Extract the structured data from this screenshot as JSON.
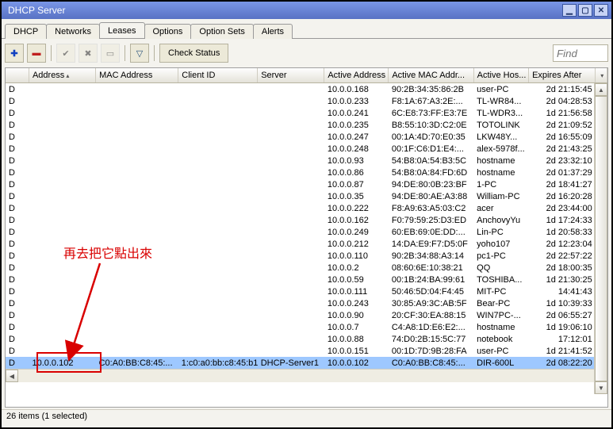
{
  "window": {
    "title": "DHCP Server"
  },
  "tabs": {
    "items": [
      "DHCP",
      "Networks",
      "Leases",
      "Options",
      "Option Sets",
      "Alerts"
    ],
    "active": 2
  },
  "toolbar": {
    "add_icon": "✚",
    "remove_icon": "▬",
    "check_icon": "✔",
    "x_icon": "✖",
    "doc_icon": "▭",
    "funnel_icon": "▽",
    "check_status_label": "Check Status",
    "find_placeholder": "Find"
  },
  "columns": [
    "",
    "Address",
    "MAC Address",
    "Client ID",
    "Server",
    "Active Address",
    "Active MAC Addr...",
    "Active Hos...",
    "Expires After",
    ""
  ],
  "dropdown_glyph": "▾",
  "rows": [
    {
      "a": "",
      "m": "",
      "c": "",
      "s": "",
      "aa": "10.0.0.168",
      "am": "90:2B:34:35:86:2B",
      "ah": "user-PC",
      "ex": "2d 21:15:45"
    },
    {
      "a": "",
      "m": "",
      "c": "",
      "s": "",
      "aa": "10.0.0.233",
      "am": "F8:1A:67:A3:2E:...",
      "ah": "TL-WR84...",
      "ex": "2d 04:28:53"
    },
    {
      "a": "",
      "m": "",
      "c": "",
      "s": "",
      "aa": "10.0.0.241",
      "am": "6C:E8:73:FF:E3:7E",
      "ah": "TL-WDR3...",
      "ex": "1d 21:56:58"
    },
    {
      "a": "",
      "m": "",
      "c": "",
      "s": "",
      "aa": "10.0.0.235",
      "am": "B8:55:10:3D:C2:0E",
      "ah": "TOTOLINK",
      "ex": "2d 21:09:52"
    },
    {
      "a": "",
      "m": "",
      "c": "",
      "s": "",
      "aa": "10.0.0.247",
      "am": "00:1A:4D:70:E0:35",
      "ah": "LKW48Y...",
      "ex": "2d 16:55:09"
    },
    {
      "a": "",
      "m": "",
      "c": "",
      "s": "",
      "aa": "10.0.0.248",
      "am": "00:1F:C6:D1:E4:...",
      "ah": "alex-5978f...",
      "ex": "2d 21:43:25"
    },
    {
      "a": "",
      "m": "",
      "c": "",
      "s": "",
      "aa": "10.0.0.93",
      "am": "54:B8:0A:54:B3:5C",
      "ah": "hostname",
      "ex": "2d 23:32:10"
    },
    {
      "a": "",
      "m": "",
      "c": "",
      "s": "",
      "aa": "10.0.0.86",
      "am": "54:B8:0A:84:FD:6D",
      "ah": "hostname",
      "ex": "2d 01:37:29"
    },
    {
      "a": "",
      "m": "",
      "c": "",
      "s": "",
      "aa": "10.0.0.87",
      "am": "94:DE:80:0B:23:BF",
      "ah": "1-PC",
      "ex": "2d 18:41:27"
    },
    {
      "a": "",
      "m": "",
      "c": "",
      "s": "",
      "aa": "10.0.0.35",
      "am": "94:DE:80:AE:A3:88",
      "ah": "William-PC",
      "ex": "2d 16:20:28"
    },
    {
      "a": "",
      "m": "",
      "c": "",
      "s": "",
      "aa": "10.0.0.222",
      "am": "F8:A9:63:A5:03:C2",
      "ah": "acer",
      "ex": "2d 23:44:00"
    },
    {
      "a": "",
      "m": "",
      "c": "",
      "s": "",
      "aa": "10.0.0.162",
      "am": "F0:79:59:25:D3:ED",
      "ah": "AnchovyYu",
      "ex": "1d 17:24:33"
    },
    {
      "a": "",
      "m": "",
      "c": "",
      "s": "",
      "aa": "10.0.0.249",
      "am": "60:EB:69:0E:DD:...",
      "ah": "Lin-PC",
      "ex": "1d 20:58:33"
    },
    {
      "a": "",
      "m": "",
      "c": "",
      "s": "",
      "aa": "10.0.0.212",
      "am": "14:DA:E9:F7:D5:0F",
      "ah": "yoho107",
      "ex": "2d 12:23:04"
    },
    {
      "a": "",
      "m": "",
      "c": "",
      "s": "",
      "aa": "10.0.0.110",
      "am": "90:2B:34:88:A3:14",
      "ah": "pc1-PC",
      "ex": "2d 22:57:22"
    },
    {
      "a": "",
      "m": "",
      "c": "",
      "s": "",
      "aa": "10.0.0.2",
      "am": "08:60:6E:10:38:21",
      "ah": "QQ",
      "ex": "2d 18:00:35"
    },
    {
      "a": "",
      "m": "",
      "c": "",
      "s": "",
      "aa": "10.0.0.59",
      "am": "00:1B:24:BA:99:61",
      "ah": "TOSHIBA...",
      "ex": "1d 21:30:25"
    },
    {
      "a": "",
      "m": "",
      "c": "",
      "s": "",
      "aa": "10.0.0.111",
      "am": "50:46:5D:04:F4:45",
      "ah": "MIT-PC",
      "ex": "14:41:43"
    },
    {
      "a": "",
      "m": "",
      "c": "",
      "s": "",
      "aa": "10.0.0.243",
      "am": "30:85:A9:3C:AB:5F",
      "ah": "Bear-PC",
      "ex": "1d 10:39:33"
    },
    {
      "a": "",
      "m": "",
      "c": "",
      "s": "",
      "aa": "10.0.0.90",
      "am": "20:CF:30:EA:88:15",
      "ah": "WIN7PC-...",
      "ex": "2d 06:55:27"
    },
    {
      "a": "",
      "m": "",
      "c": "",
      "s": "",
      "aa": "10.0.0.7",
      "am": "C4:A8:1D:E6:E2:...",
      "ah": "hostname",
      "ex": "1d 19:06:10"
    },
    {
      "a": "",
      "m": "",
      "c": "",
      "s": "",
      "aa": "10.0.0.88",
      "am": "74:D0:2B:15:5C:77",
      "ah": "notebook",
      "ex": "17:12:01"
    },
    {
      "a": "",
      "m": "",
      "c": "",
      "s": "",
      "aa": "10.0.0.151",
      "am": "00:1D:7D:9B:28:FA",
      "ah": "user-PC",
      "ex": "1d 21:41:52"
    },
    {
      "a": "10.0.0.102",
      "m": "C0:A0:BB:C8:45:...",
      "c": "1:c0:a0:bb:c8:45:b1",
      "s": "DHCP-Server1",
      "aa": "10.0.0.102",
      "am": "C0:A0:BB:C8:45:...",
      "ah": "DIR-600L",
      "ex": "2d 08:22:20",
      "sel": true
    }
  ],
  "row_flag": "D",
  "status_text": "26 items (1 selected)",
  "annotation": {
    "text": "再去把它點出來"
  },
  "scroll_arrows": {
    "up": "▲",
    "down": "▼",
    "left": "◀",
    "right": "▶"
  }
}
